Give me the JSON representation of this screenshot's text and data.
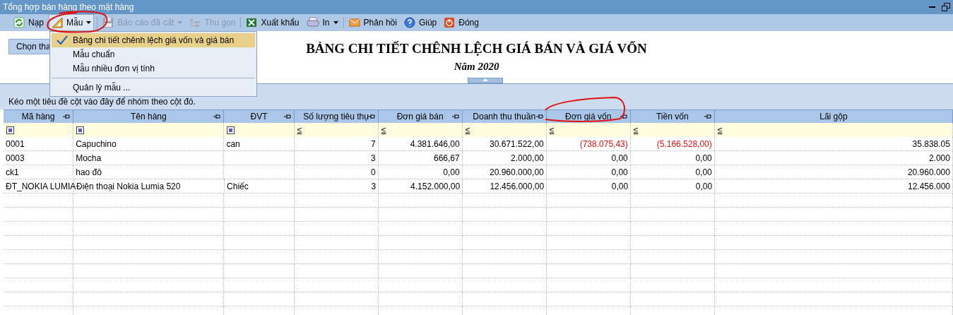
{
  "window": {
    "title": "Tổng hợp bán hàng theo mặt hàng"
  },
  "toolbar": [
    {
      "label": "Nạp",
      "kind": "reload",
      "disabled": false,
      "dropdown": false,
      "selected": false
    },
    {
      "label": "Mẫu",
      "kind": "template",
      "disabled": false,
      "dropdown": true,
      "selected": true
    },
    {
      "label": "Báo cáo đã cất",
      "kind": "save",
      "disabled": true,
      "dropdown": true,
      "selected": false
    },
    {
      "label": "Thu gọn",
      "kind": "collapse",
      "disabled": true,
      "dropdown": false,
      "selected": false
    },
    {
      "label": "Xuất khẩu",
      "kind": "excel",
      "disabled": false,
      "dropdown": false,
      "selected": false
    },
    {
      "label": "In",
      "kind": "print",
      "disabled": false,
      "dropdown": true,
      "selected": false
    },
    {
      "label": "Phản hồi",
      "kind": "mail",
      "disabled": false,
      "dropdown": false,
      "selected": false
    },
    {
      "label": "Giúp",
      "kind": "help",
      "disabled": false,
      "dropdown": false,
      "selected": false
    },
    {
      "label": "Đóng",
      "kind": "close",
      "disabled": false,
      "dropdown": false,
      "selected": false
    }
  ],
  "template_menu": [
    {
      "label": "Bảng chi tiết chênh lệch giá vốn và giá bán",
      "checked": true,
      "separator_before": false
    },
    {
      "label": "Mẫu chuẩn",
      "checked": false,
      "separator_before": false
    },
    {
      "label": "Mẫu nhiều đơn vị tính",
      "checked": false,
      "separator_before": false
    },
    {
      "label": "Quản lý mẫu ...",
      "checked": false,
      "separator_before": true
    }
  ],
  "parameter_button": "Chọn tha",
  "report": {
    "title": "BẢNG CHI TIẾT CHÊNH LỆCH GIÁ BÁN VÀ GIÁ VỐN",
    "subtitle": "Năm 2020"
  },
  "group_panel": "Kéo một tiêu đề cột vào đây để nhóm theo cột đó.",
  "table": {
    "columns": [
      {
        "label": "Mã hàng",
        "filter": {
          "kind": "checkbox"
        },
        "pin": true
      },
      {
        "label": "Tên hàng",
        "filter": {
          "kind": "checkbox"
        },
        "pin": true
      },
      {
        "label": "ĐVT",
        "filter": {
          "kind": "checkbox"
        },
        "pin": true
      },
      {
        "label": "Số lượng tiêu thụ",
        "filter": {
          "kind": "operator",
          "symbol": "≤"
        },
        "pin": true
      },
      {
        "label": "Đơn giá bán",
        "filter": {
          "kind": "operator",
          "symbol": "≤"
        },
        "pin": true
      },
      {
        "label": "Doanh thu thuần",
        "filter": {
          "kind": "operator",
          "symbol": "≤"
        },
        "pin": true
      },
      {
        "label": "Đơn giá vốn",
        "filter": {
          "kind": "operator",
          "symbol": "≤"
        },
        "pin": true
      },
      {
        "label": "Tiền vốn",
        "filter": {
          "kind": "operator",
          "symbol": "≤"
        },
        "pin": true
      },
      {
        "label": "Lãi gộp",
        "filter": {
          "kind": "operator",
          "symbol": "≤"
        },
        "pin": false
      }
    ],
    "rows": [
      {
        "code": "0001",
        "name": "Capuchino",
        "unit": "can",
        "values": [
          {
            "text": "7",
            "negative": false
          },
          {
            "text": "4.381.646,00",
            "negative": false
          },
          {
            "text": "30.671.522,00",
            "negative": false
          },
          {
            "text": "(738.075,43)",
            "negative": true
          },
          {
            "text": "(5.166.528,00)",
            "negative": true
          },
          {
            "text": "35.838.05",
            "negative": false
          }
        ]
      },
      {
        "code": "0003",
        "name": "Mocha",
        "values": [
          {
            "text": "3",
            "negative": false
          },
          {
            "text": "666,67",
            "negative": false
          },
          {
            "text": "2.000,00",
            "negative": false
          },
          {
            "text": "0,00",
            "negative": false
          },
          {
            "text": "0,00",
            "negative": false
          },
          {
            "text": "2.000",
            "negative": false
          }
        ]
      },
      {
        "code": "ck1",
        "name": "hao đô",
        "values": [
          {
            "text": "0",
            "negative": false
          },
          {
            "text": "0,00",
            "negative": false
          },
          {
            "text": "20.960.000,00",
            "negative": false
          },
          {
            "text": "0,00",
            "negative": false
          },
          {
            "text": "0,00",
            "negative": false
          },
          {
            "text": "20.960.000",
            "negative": false
          }
        ]
      },
      {
        "code": "ĐT_NOKIA LUMIA",
        "name": "Điện thoại Nokia Lumia 520",
        "unit": "Chiếc",
        "values": [
          {
            "text": "3",
            "negative": false
          },
          {
            "text": "4.152.000,00",
            "negative": false
          },
          {
            "text": "12.456.000,00",
            "negative": false
          },
          {
            "text": "0,00",
            "negative": false
          },
          {
            "text": "0,00",
            "negative": false
          },
          {
            "text": "12.456.000",
            "negative": false
          }
        ]
      }
    ]
  }
}
